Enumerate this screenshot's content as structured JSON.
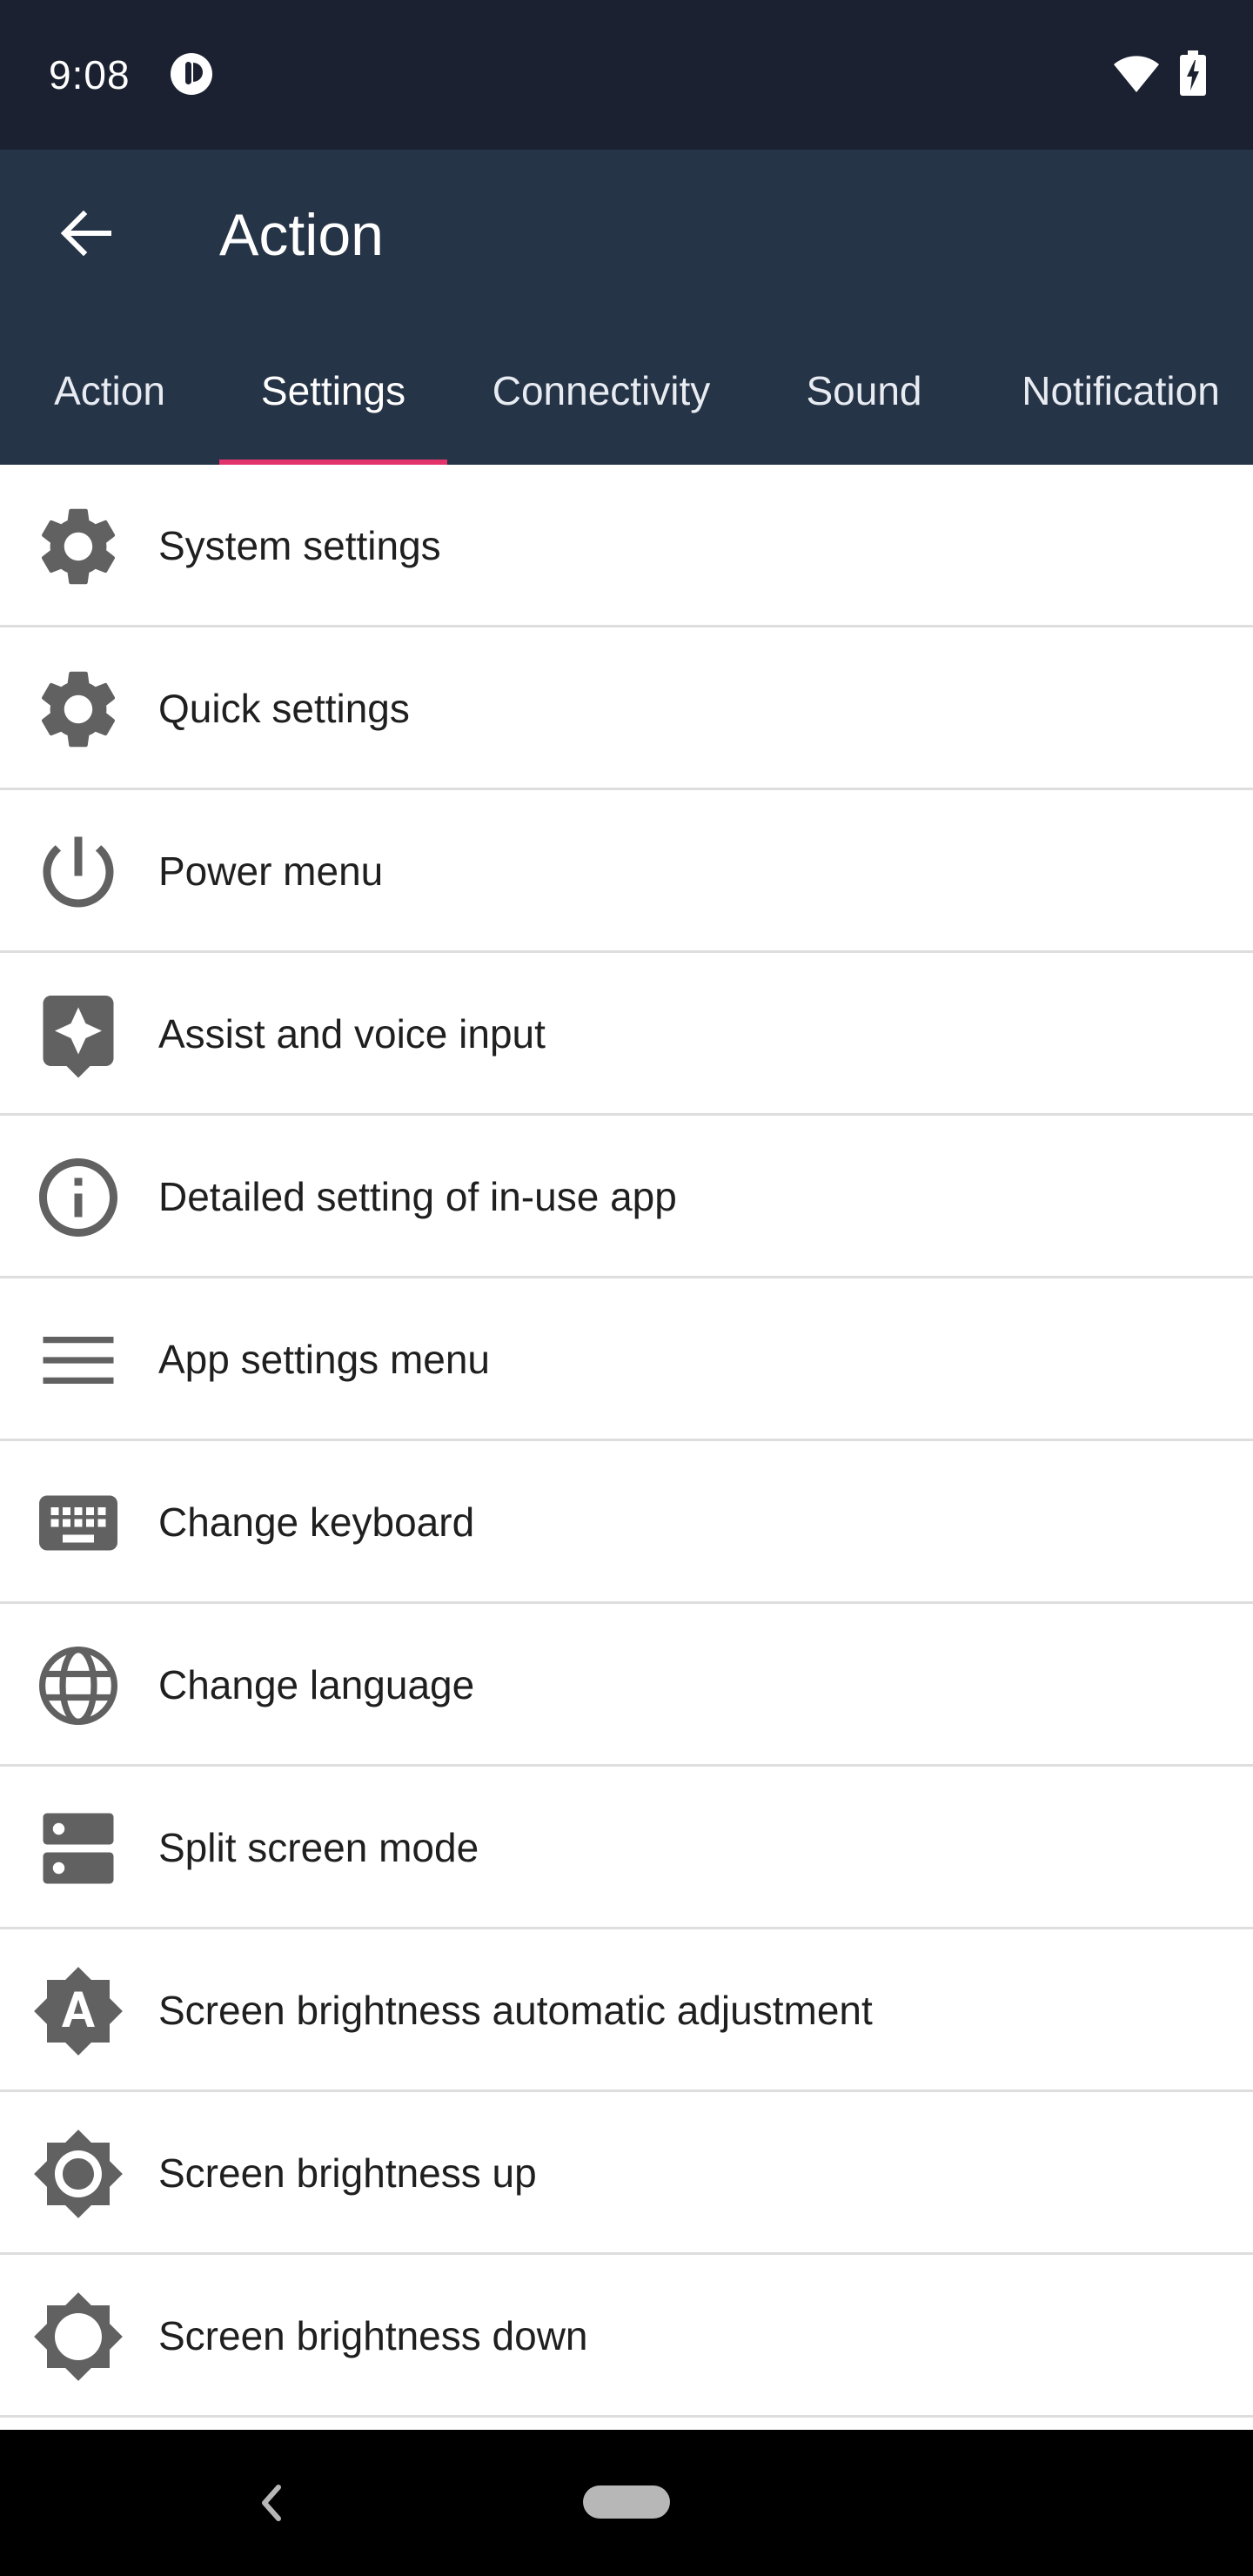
{
  "status_bar": {
    "time": "9:08",
    "app_icon": "pocket-app-icon",
    "wifi_icon": "wifi-icon",
    "battery_icon": "battery-charging-icon"
  },
  "app_bar": {
    "back_icon": "arrow-back-icon",
    "title": "Action"
  },
  "tabs": [
    {
      "label": "Action",
      "active": false
    },
    {
      "label": "Settings",
      "active": true
    },
    {
      "label": "Connectivity",
      "active": false
    },
    {
      "label": "Sound",
      "active": false
    },
    {
      "label": "Notification",
      "active": false
    }
  ],
  "items": [
    {
      "label": "System settings",
      "icon": "gear-icon"
    },
    {
      "label": "Quick settings",
      "icon": "gear-icon"
    },
    {
      "label": "Power menu",
      "icon": "power-icon"
    },
    {
      "label": "Assist and voice input",
      "icon": "assistant-icon"
    },
    {
      "label": "Detailed setting of in-use app",
      "icon": "info-icon"
    },
    {
      "label": "App settings menu",
      "icon": "menu-icon"
    },
    {
      "label": "Change keyboard",
      "icon": "keyboard-icon"
    },
    {
      "label": "Change language",
      "icon": "globe-icon"
    },
    {
      "label": "Split screen mode",
      "icon": "split-screen-icon"
    },
    {
      "label": "Screen brightness automatic adjustment",
      "icon": "brightness-auto-icon"
    },
    {
      "label": "Screen brightness up",
      "icon": "brightness-up-icon"
    },
    {
      "label": "Screen brightness down",
      "icon": "brightness-down-icon"
    }
  ],
  "nav_bar": {
    "back_icon": "nav-back-icon",
    "home_icon": "home-pill-icon"
  },
  "colors": {
    "status_bar": "#1b2130",
    "app_bar": "#263447",
    "tab_indicator": "#e2336b",
    "icon_gray": "#616161"
  }
}
